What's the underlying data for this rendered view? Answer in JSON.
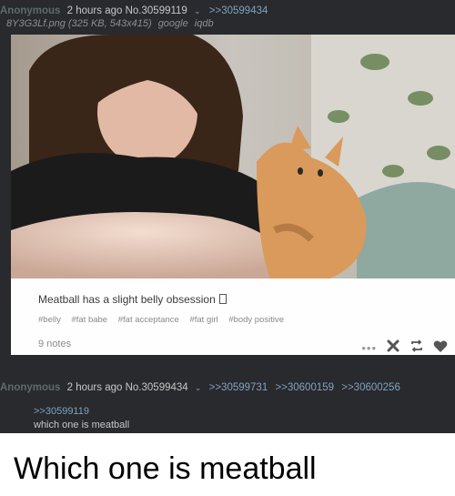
{
  "post1": {
    "name": "Anonymous",
    "time": "2 hours ago",
    "post_no": "No.30599119",
    "reply_link": ">>30599434",
    "file": "8Y3G3Lf.png (325 KB, 543x415)",
    "google": "google",
    "iqdb": "iqdb"
  },
  "tumblr": {
    "caption": "Meatball has a slight belly obsession",
    "tags": [
      "#belly",
      "#fat babe",
      "#fat acceptance",
      "#fat girl",
      "#body positive"
    ],
    "notes": "9 notes",
    "icons": [
      "more-icon",
      "close-icon",
      "reblog-icon",
      "heart-icon"
    ]
  },
  "post2": {
    "name": "Anonymous",
    "time": "2 hours ago",
    "post_no": "No.30599434",
    "replies": [
      ">>30599731",
      ">>30600159",
      ">>30600256"
    ],
    "quote": ">>30599119",
    "message": "which one is meatball"
  },
  "meme_caption": "Which one is meatball",
  "colors": {
    "board_bg": "#282a2e",
    "link": "#81a2be",
    "name": "#5f6b6b",
    "text": "#c5c8c6"
  }
}
